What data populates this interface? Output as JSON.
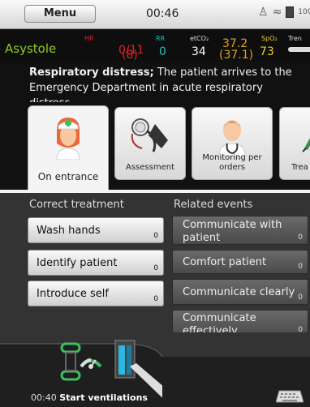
{
  "topbar": {
    "menu_label": "Menu",
    "clock": "00:46",
    "icons": [
      "person-icon",
      "wifi-icon",
      "battery-icon"
    ],
    "battery_text": "100"
  },
  "vitals": {
    "rhythm": "Asystole",
    "hr": {
      "label": "HR",
      "value": "0/11",
      "sub": "(8)",
      "color": "#e0202a"
    },
    "rr": {
      "label": "RR",
      "value": "0",
      "color": "#20c0c0"
    },
    "etco2": {
      "label": "etCO₂",
      "value": "34",
      "color": "#ffffff"
    },
    "temp": {
      "value": "37.2",
      "sub": "(37.1)",
      "color": "#e0a020"
    },
    "spo2": {
      "label": "SpO₂",
      "value": "73",
      "color": "#f0d020"
    },
    "trend_label": "Tren"
  },
  "scenario": {
    "title": "Respiratory distress;",
    "text": " The patient arrives to the Emergency Department in acute respiratory distress."
  },
  "tabs": [
    {
      "label": "On entrance",
      "icon": "nurse-icon",
      "active": true
    },
    {
      "label": "Assessment",
      "icon": "stethoscope-icon",
      "active": false
    },
    {
      "label": "Monitoring per orders",
      "icon": "doctor-icon",
      "active": false
    },
    {
      "label": "Trea",
      "icon": "syringe-icon",
      "active": false
    }
  ],
  "columns": {
    "correct_treatment": "Correct treatment",
    "related_events": "Related events"
  },
  "treatments": [
    {
      "label": "Wash hands",
      "count": "0"
    },
    {
      "label": "Identify patient",
      "count": "0"
    },
    {
      "label": "Introduce self",
      "count": "0"
    }
  ],
  "events": [
    {
      "label": "Communicate with patient",
      "count": "0"
    },
    {
      "label": "Comfort patient",
      "count": "0"
    },
    {
      "label": "Communicate clearly",
      "count": "0"
    },
    {
      "label": "Communicate effectively",
      "count": "0"
    }
  ],
  "bottom": {
    "last_time": "00:40",
    "last_action": "Start ventilations"
  },
  "colors": {
    "rhythm": "#8ccf1f",
    "accent_cyan": "#2ab8e0",
    "accent_green": "#3cc060"
  }
}
